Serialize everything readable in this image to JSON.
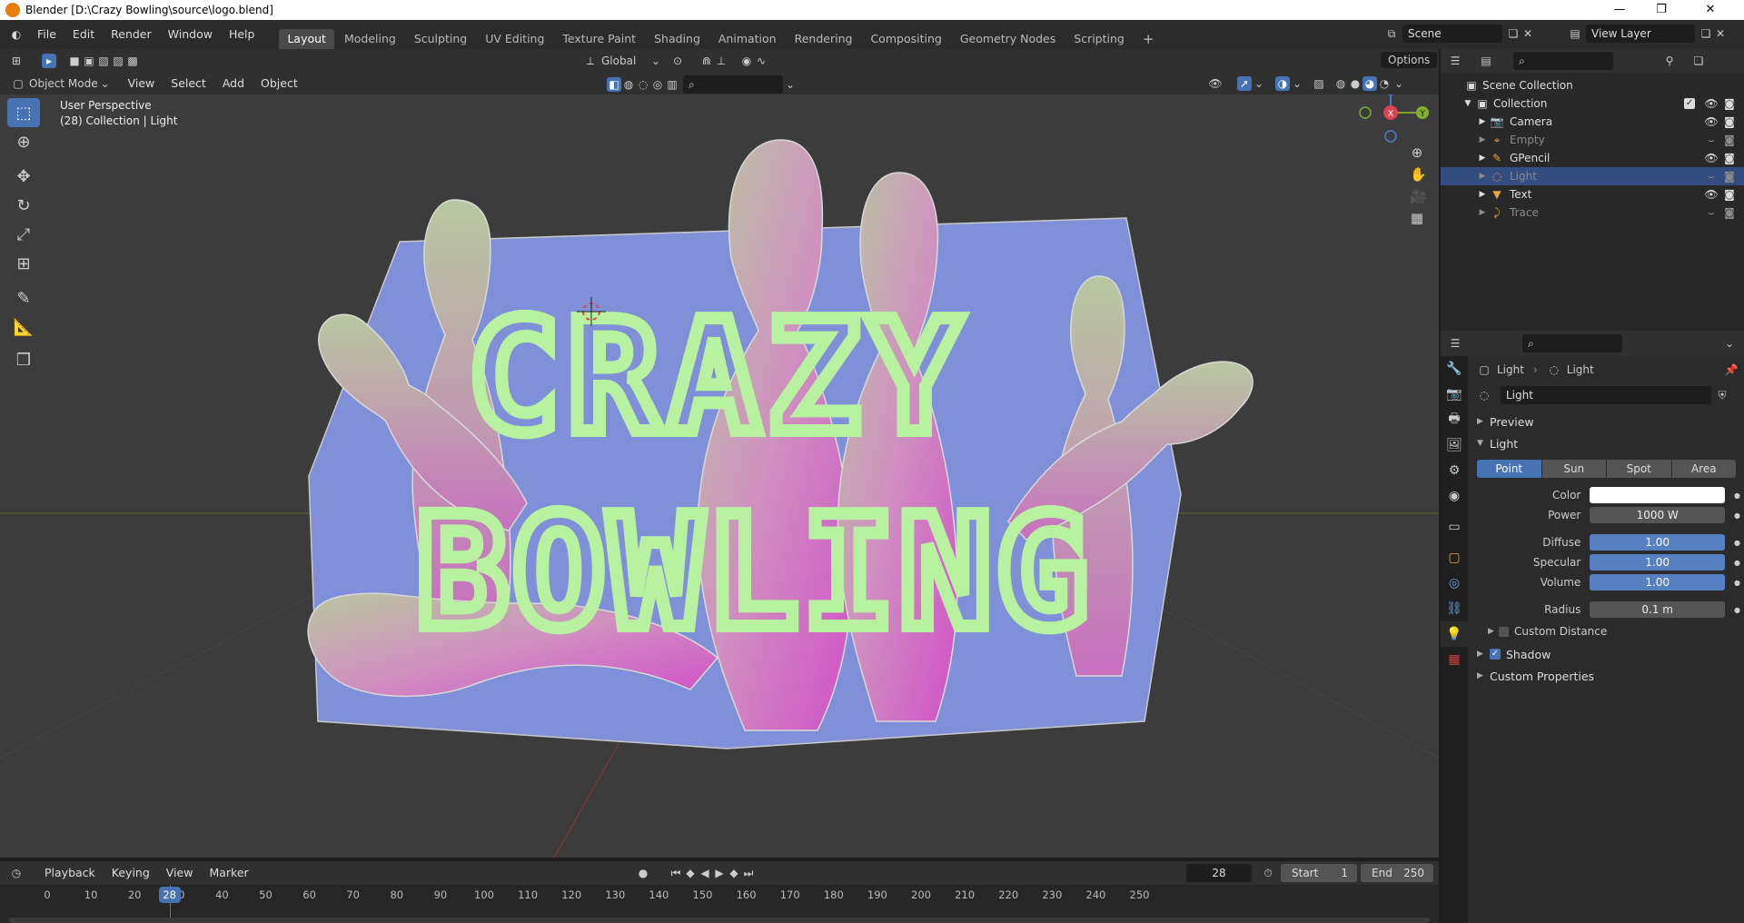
{
  "window": {
    "title": "Blender [D:\\Crazy Bowling\\source\\logo.blend]",
    "minimize": "—",
    "maximize": "❐",
    "close": "✕"
  },
  "menu": [
    "File",
    "Edit",
    "Render",
    "Window",
    "Help"
  ],
  "workspaces": [
    "Layout",
    "Modeling",
    "Sculpting",
    "UV Editing",
    "Texture Paint",
    "Shading",
    "Animation",
    "Rendering",
    "Compositing",
    "Geometry Nodes",
    "Scripting"
  ],
  "active_workspace": "Layout",
  "add_workspace": "+",
  "scene": {
    "name": "Scene",
    "view_layer": "View Layer"
  },
  "viewport_header": {
    "transform_orientation": "Global",
    "options": "Options"
  },
  "viewport_header2": {
    "mode": "Object Mode",
    "menus": [
      "View",
      "Select",
      "Add",
      "Object"
    ]
  },
  "viewport": {
    "perspective_label": "User Perspective",
    "collection_label": "(28) Collection | Light",
    "logo_line1": "CRAZY",
    "logo_line2": "BOWLING",
    "gizmo": {
      "z": "Z",
      "x": "X",
      "y": "Y"
    }
  },
  "outliner": {
    "scene_collection": "Scene Collection",
    "collection": "Collection",
    "items": [
      {
        "name": "Camera",
        "icon": "camera-icon",
        "selected": false,
        "dim": false
      },
      {
        "name": "Empty",
        "icon": "empty-icon",
        "selected": false,
        "dim": true
      },
      {
        "name": "GPencil",
        "icon": "gpencil-icon",
        "selected": false,
        "dim": false
      },
      {
        "name": "Light",
        "icon": "light-icon",
        "selected": true,
        "dim": true
      },
      {
        "name": "Text",
        "icon": "text-icon",
        "selected": false,
        "dim": false
      },
      {
        "name": "Trace",
        "icon": "trace-icon",
        "selected": false,
        "dim": true
      }
    ]
  },
  "properties": {
    "breadcrumb_object": "Light",
    "breadcrumb_data": "Light",
    "datablock_name": "Light",
    "panel_preview": "Preview",
    "panel_light": "Light",
    "light_types": [
      "Point",
      "Sun",
      "Spot",
      "Area"
    ],
    "active_light_type": "Point",
    "color_label": "Color",
    "power_label": "Power",
    "power_value": "1000 W",
    "diffuse_label": "Diffuse",
    "diffuse_value": "1.00",
    "specular_label": "Specular",
    "specular_value": "1.00",
    "volume_label": "Volume",
    "volume_value": "1.00",
    "radius_label": "Radius",
    "radius_value": "0.1 m",
    "custom_distance": "Custom Distance",
    "shadow": "Shadow",
    "custom_properties": "Custom Properties"
  },
  "timeline": {
    "menus": [
      "Playback",
      "Keying",
      "View",
      "Marker"
    ],
    "current_frame": "28",
    "start_label": "Start",
    "start_value": "1",
    "end_label": "End",
    "end_value": "250",
    "ticks": [
      "0",
      "10",
      "20",
      "30",
      "40",
      "50",
      "60",
      "70",
      "80",
      "90",
      "100",
      "110",
      "120",
      "130",
      "140",
      "150",
      "160",
      "170",
      "180",
      "190",
      "200",
      "210",
      "220",
      "230",
      "240",
      "250"
    ]
  },
  "colors": {
    "accent": "#4772b3",
    "selection": "#334d80",
    "logo_text": "#b8f2a0",
    "backdrop": "#8090d8",
    "pin_pink": "#d060c8"
  }
}
